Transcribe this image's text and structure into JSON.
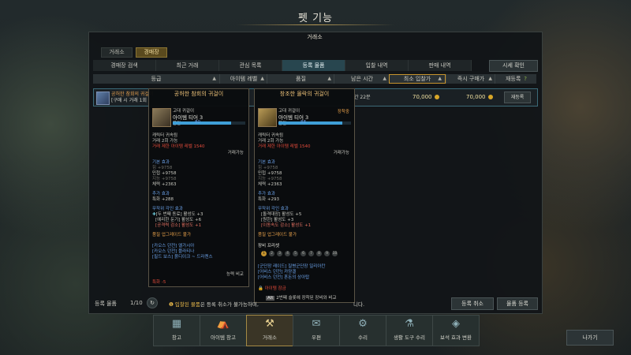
{
  "window": {
    "title": "펫 기능",
    "panel_title": "거래소"
  },
  "top_tabs": [
    {
      "label": "거래소"
    },
    {
      "label": "경매장"
    }
  ],
  "sub_tabs": [
    {
      "label": "경매장 검색"
    },
    {
      "label": "최근 거래"
    },
    {
      "label": "관심 목록"
    },
    {
      "label": "등록 물품"
    },
    {
      "label": "입찰 내역"
    },
    {
      "label": "판매 내역"
    }
  ],
  "market_check_label": "시세 확인",
  "columns": {
    "grade": "등급",
    "item_level": "아이템 레벨",
    "quality": "품질",
    "time_left": "남은 시간",
    "min_bid": "최소 입찰가",
    "buyout": "즉시 구매가",
    "reregister": "재등록"
  },
  "row": {
    "name": "공허한 참회의 귀걸이",
    "desc": "[구매 시 거래 1회",
    "time_left": "간 22분",
    "min_bid": "70,000",
    "buyout": "70,000",
    "reregister_label": "재등록"
  },
  "tooltip_left": {
    "title": "공허한 참회의 귀걸이",
    "grade": "고대 귀걸이",
    "tier": "아이템 티어 3",
    "quality_label": "품질",
    "quality_value": "80",
    "bound": "캐릭터 귀속됨",
    "trade": "거래 2회 가능",
    "limit": "거래 제한 아이템 레벨 1540",
    "tradeable": "거래가능",
    "base_title": "기본 효과",
    "base1": "힘 +9758",
    "base2": "민첩 +9758",
    "base3": "지능 +9758",
    "base4": "체력 +2363",
    "extra_title": "추가 효과",
    "extra1": "특화 +288",
    "random_title": "무작위 각인 효과",
    "eng1": "[두 번째 동료] 활성도 +3",
    "eng2": "[예리한 둔기] 활성도 +6",
    "eng3": "[공격력 감소] 활성도 +1",
    "upgrade": "품질 업그레이드 불가",
    "chaos1": "[카오스 던전] 엘가시아",
    "chaos2": "[카오스 던전] 플라티나",
    "chaos3": "[필드 보스] 붉디이크 ~ 드라켄스",
    "compare": "능력 비교",
    "special": "특화 -5"
  },
  "tooltip_right": {
    "title": "창조한 몰락의 귀걸이",
    "equipped": "장착중",
    "grade": "고대 귀걸이",
    "tier": "아이템 티어 3",
    "quality_label": "품질",
    "quality_value": "88",
    "bound": "캐릭터 귀속됨",
    "trade": "거래 2회 가능",
    "limit": "거래 제한 아이템 레벨 1540",
    "tradeable": "거래가능",
    "base_title": "기본 효과",
    "base1": "힘 +9758",
    "base2": "민첩 +9758",
    "base3": "지능 +9758",
    "base4": "체력 +2363",
    "extra_title": "추가 효과",
    "extra1": "특화 +293",
    "random_title": "무작위 각인 효과",
    "eng1": "[돌격대장] 활성도 +5",
    "eng2": "[원한] 활성도 +3",
    "eng3": "[이동속도 감소] 활성도 +1",
    "upgrade": "품질 업그레이드 불가",
    "preset_title": "장비 프리셋",
    "presets": [
      "1",
      "2",
      "3",
      "4",
      "5",
      "6",
      "7",
      "8",
      "9",
      "10"
    ],
    "src1": "[군단장 레이드] 질병군단장 일리아칸",
    "src2": "[어비스 던전] 카양겔",
    "src3": "[어비스 던전] 혼돈의 상아탑",
    "locked": "아이템 잠금",
    "alt_key": "Alt",
    "alt_hint": "2번째 슬롯에 장착된 장비와 비교"
  },
  "footer": {
    "registered_label": "등록 물품",
    "count": "1/10",
    "notice_a": "입찰된 물품",
    "notice_b": "은 등록 취소가 불가능하며,",
    "notice_c": "니다.",
    "cancel_label": "등록 취소",
    "register_label": "물품 등록"
  },
  "dock": [
    {
      "label": "창고",
      "icon": "warehouse-icon"
    },
    {
      "label": "아이템 창고",
      "icon": "item-storage-icon"
    },
    {
      "label": "거래소",
      "icon": "auction-gavel-icon"
    },
    {
      "label": "우편",
      "icon": "mail-icon"
    },
    {
      "label": "수리",
      "icon": "anvil-icon"
    },
    {
      "label": "생활 도구 수리",
      "icon": "tool-repair-icon"
    },
    {
      "label": "보석 효과 변환",
      "icon": "gem-convert-icon"
    }
  ],
  "exit_label": "나가기",
  "colors": {
    "accent": "#c6942e",
    "active_tab": "#28464f",
    "gold_text": "#f0c47a"
  }
}
